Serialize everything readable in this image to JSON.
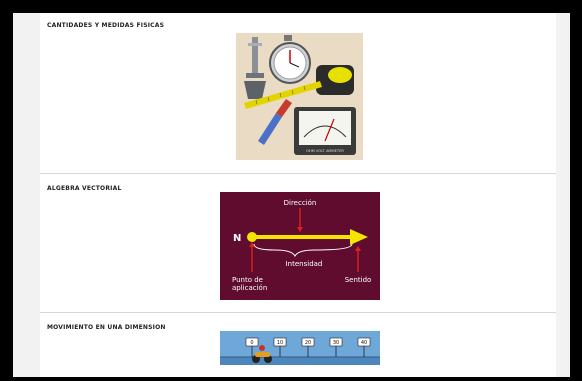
{
  "sections": [
    {
      "title": "CANTIDADES Y MEDIDAS FISICAS",
      "image_icon": "measuring-instruments-illustration",
      "gauge_label": "OHM VOLT AMMETER"
    },
    {
      "title": "ALGEBRA VECTORIAL",
      "image_icon": "vector-diagram",
      "diagram": {
        "origin": "N",
        "direction": "Dirección",
        "magnitude": "Intensidad",
        "application_point_line1": "Punto de",
        "application_point_line2": "aplicación",
        "sense": "Sentido"
      }
    },
    {
      "title": "MOVIMIENTO EN UNA DIMENSION",
      "image_icon": "motorcycle-distance-markers",
      "markers": [
        "0",
        "10",
        "20",
        "30",
        "40"
      ]
    }
  ],
  "colors": {
    "vector_bg": "#5a0a2a",
    "arrow": "#f2e600",
    "marker_red": "#e02020",
    "track_bg": "#6fa8d8"
  }
}
